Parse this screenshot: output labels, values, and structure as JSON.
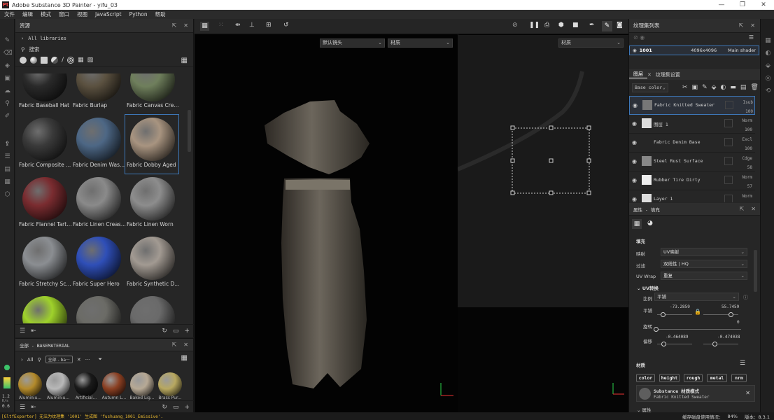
{
  "window": {
    "title": "Adobe Substance 3D Painter - yifu_03",
    "logo": "Pt"
  },
  "menu": [
    "文件",
    "编辑",
    "模式",
    "窗口",
    "视图",
    "JavaScript",
    "Python",
    "帮助"
  ],
  "assets": {
    "title": "资源",
    "libraries": "All libraries",
    "search_placeholder": "搜索",
    "materials": [
      {
        "name": "Fabric Baseball Hat",
        "color": "#2a2a2a"
      },
      {
        "name": "Fabric Burlap",
        "color": "#5b5140"
      },
      {
        "name": "Fabric Canvas Cre...",
        "color": "#6f7f5c"
      },
      {
        "name": "Fabric Composite ...",
        "color": "#3a3a3a"
      },
      {
        "name": "Fabric Denim Was...",
        "color": "#4d6785"
      },
      {
        "name": "Fabric Dobby Aged",
        "color": "#a89480"
      },
      {
        "name": "Fabric Flannel Tartan",
        "color": "#7a2c30"
      },
      {
        "name": "Fabric Linen Creas...",
        "color": "#8a8a8a"
      },
      {
        "name": "Fabric Linen Worn",
        "color": "#8d8d8d"
      },
      {
        "name": "Fabric Stretchy Sci-Fi",
        "color": "#8b8e92"
      },
      {
        "name": "Fabric Super Hero",
        "color": "#2f4fb8"
      },
      {
        "name": "Fabric Synthetic D...",
        "color": "#a29a92"
      },
      {
        "name": "",
        "color": "#9fd22b"
      },
      {
        "name": "",
        "color": "#6b6b66"
      },
      {
        "name": "",
        "color": "#6a6a6a"
      }
    ],
    "selected_index": 5
  },
  "shelf": {
    "title": "全部 - BASEMATERIAL",
    "filter_label": "All",
    "tag": "全部 - ba···",
    "items": [
      {
        "name": "Aluminiu...",
        "color": "#b38a2b"
      },
      {
        "name": "Aluminiu...",
        "color": "#b8b8b8"
      },
      {
        "name": "Artificial...",
        "color": "#1a1a1a"
      },
      {
        "name": "Autumn L...",
        "color": "#8a3f22"
      },
      {
        "name": "Baked Lig...",
        "color": "#b7a995"
      },
      {
        "name": "Brass Pur...",
        "color": "#b8a860"
      }
    ]
  },
  "viewport": {
    "camera": "默认镜头",
    "channel_left": "材质",
    "channel_right": "材质"
  },
  "texture_sets": {
    "title": "纹理集列表",
    "set_name": "1001",
    "resolution": "4096x4096",
    "shader": "Main shader"
  },
  "layers": {
    "tab1": "图层",
    "tab2": "纹理集设置",
    "channel": "Base color",
    "items": [
      {
        "name": "Fabric Knitted Sweater",
        "blend": "Isub",
        "opacity": "100",
        "thumb": "#777",
        "selected": true
      },
      {
        "name": "图层 1",
        "blend": "Norm",
        "opacity": "100",
        "thumb": "#ddd",
        "selected": false
      },
      {
        "name": "Fabric Denim Base",
        "blend": "Excl",
        "opacity": "100",
        "thumb": "#262626",
        "selected": false
      },
      {
        "name": "Steel Rust Surface",
        "blend": "Cdge",
        "opacity": "58",
        "thumb": "#888",
        "selected": false
      },
      {
        "name": "Rubber Tire Dirty",
        "blend": "Norm",
        "opacity": "57",
        "thumb": "#eee",
        "selected": false
      },
      {
        "name": "Layer 1",
        "blend": "Norm",
        "opacity": "",
        "thumb": "#ddd",
        "selected": false
      }
    ]
  },
  "properties": {
    "title": "属性 - 填充",
    "section_fill": "填充",
    "mapping_label": "映射",
    "mapping_value": "UV映射",
    "filter_label": "过滤",
    "filter_value": "双线性 | HQ",
    "uvwrap_label": "UV Wrap",
    "uvwrap_value": "重复",
    "uv_transform": "UV转换",
    "scale_label": "比例",
    "scale_value": "平铺",
    "tile_label": "平铺",
    "tile_u": "-73.2859",
    "tile_v": "55.7459",
    "rotation_label": "旋转",
    "rotation_value": "0",
    "offset_label": "偏移",
    "offset_u": "-0.464089",
    "offset_v": "-0.474038",
    "material_section": "材质",
    "channels": [
      "color",
      "height",
      "rough",
      "metal",
      "nrm"
    ],
    "material_mode": "Substance 材质模式",
    "material_name": "Fabric Knitted Sweater",
    "more_section": "属性"
  },
  "status": {
    "message": "[GltfExporter] 无法为纹理集 '1001' 生成图 'fushuang_1001_Emissive'.",
    "cache": "缓存磁盘使用情况：",
    "cache_value": "84%",
    "version": "版本：8.3.1"
  },
  "left_meter": {
    "value": "1.2",
    "unit": "K/s",
    "value2": "0.6"
  },
  "colors": {
    "accent": "#3d77b8",
    "panel": "#262626",
    "viewport": "#030303"
  }
}
